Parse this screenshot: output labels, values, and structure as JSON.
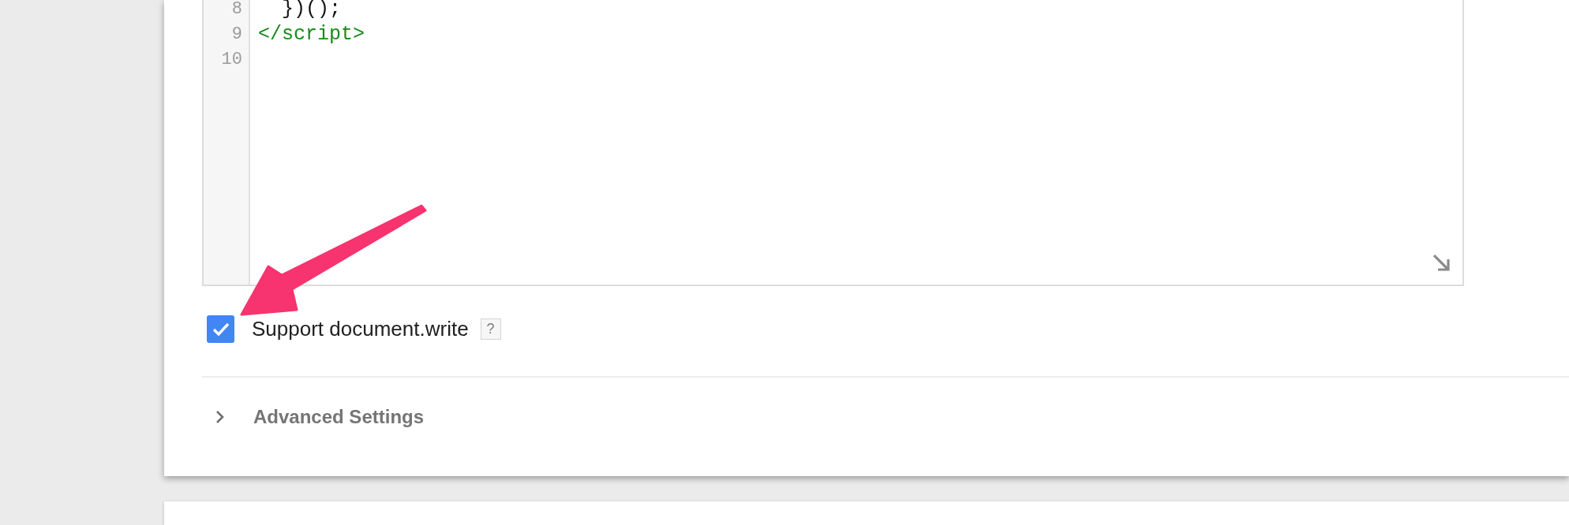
{
  "editor": {
    "lines": [
      {
        "number": "8",
        "code": "  })();",
        "kind": "plain"
      },
      {
        "number": "9",
        "code": "</script>",
        "kind": "tag"
      },
      {
        "number": "10"
      }
    ]
  },
  "support_document_write": {
    "label": "Support document.write",
    "checked": true,
    "help": "?"
  },
  "advanced_settings": {
    "label": "Advanced Settings",
    "expanded": false
  }
}
